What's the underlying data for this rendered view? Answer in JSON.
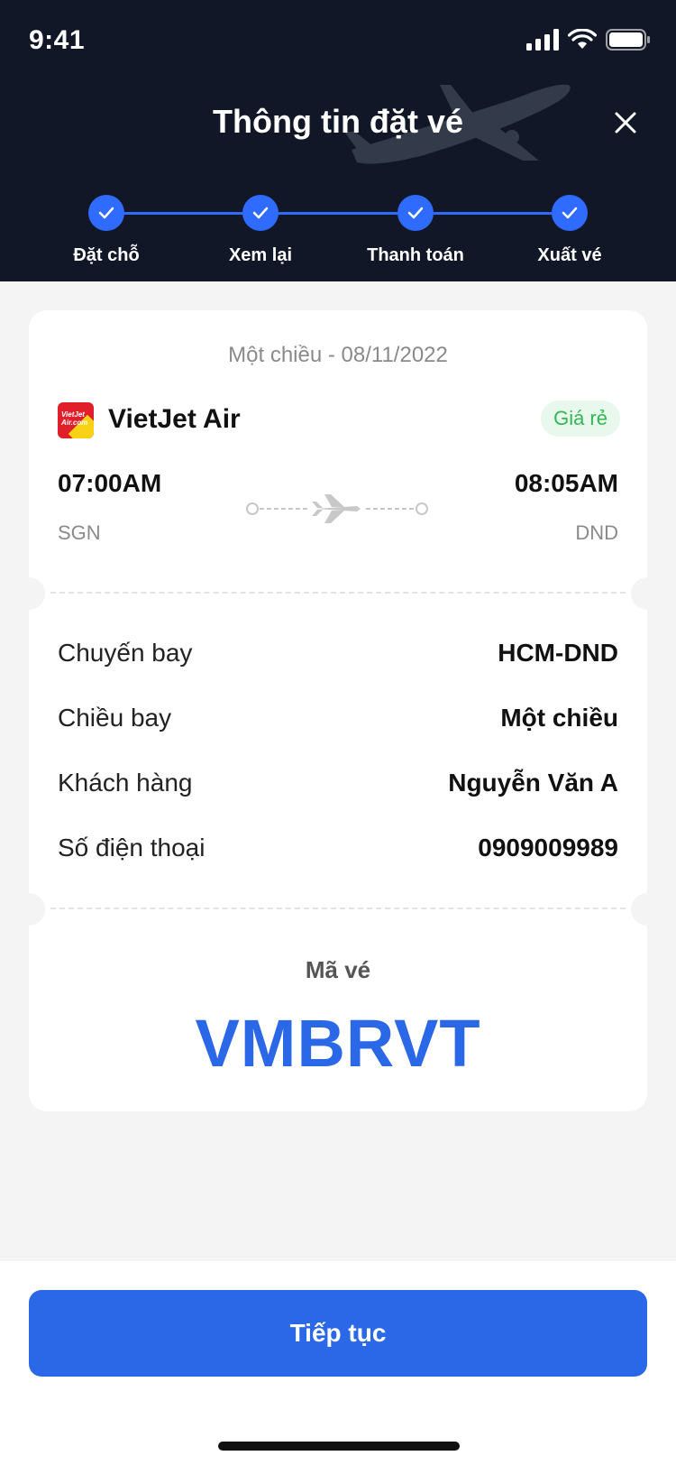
{
  "status_bar": {
    "time": "9:41"
  },
  "header": {
    "title": "Thông tin đặt vé"
  },
  "steps": [
    {
      "label": "Đặt chỗ",
      "done": true
    },
    {
      "label": "Xem lại",
      "done": true
    },
    {
      "label": "Thanh toán",
      "done": true
    },
    {
      "label": "Xuất vé",
      "done": true
    }
  ],
  "ticket": {
    "trip_date": "Một chiều - 08/11/2022",
    "airline": "VietJet Air",
    "badge": "Giá rẻ",
    "depart_time": "07:00AM",
    "arrive_time": "08:05AM",
    "depart_code": "SGN",
    "arrive_code": "DND",
    "details": [
      {
        "label": "Chuyến bay",
        "value": "HCM-DND"
      },
      {
        "label": "Chiều bay",
        "value": "Một chiều"
      },
      {
        "label": "Khách hàng",
        "value": "Nguyễn Văn A"
      },
      {
        "label": "Số điện thoại",
        "value": "0909009989"
      }
    ],
    "code_label": "Mã vé",
    "code": "VMBRVT"
  },
  "actions": {
    "continue_label": "Tiếp tục"
  },
  "colors": {
    "accent": "#2A68E8",
    "header_bg": "#111727",
    "badge_bg": "#E8F8EC",
    "badge_text": "#32B854"
  },
  "icons": [
    "signal-icon",
    "wifi-icon",
    "battery-icon",
    "close-icon",
    "check-icon",
    "airplane-icon",
    "vietjet-logo"
  ]
}
